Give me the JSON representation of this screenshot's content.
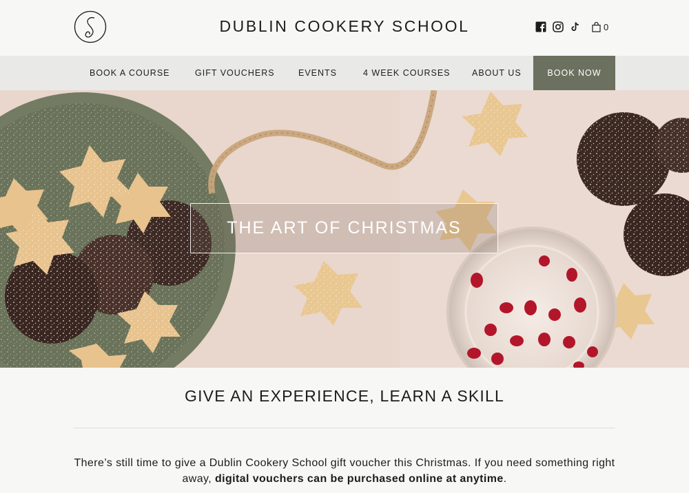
{
  "header": {
    "logo_icon": "s-monogram-logo",
    "title": "DUBLIN COOKERY SCHOOL",
    "social_icons": [
      "facebook-icon",
      "instagram-icon",
      "tiktok-icon"
    ],
    "cart_count": "0"
  },
  "nav": {
    "items": [
      "BOOK A COURSE",
      "GIFT VOUCHERS",
      "EVENTS",
      "4 WEEK COURSES",
      "ABOUT US"
    ],
    "cta": "BOOK NOW"
  },
  "hero": {
    "title": "THE ART OF CHRISTMAS"
  },
  "section": {
    "title": "GIVE AN EXPERIENCE, LEARN A SKILL",
    "text_part1": "There’s still time to give a Dublin Cookery School gift voucher this Christmas. If you need something right away, ",
    "text_bold": "digital vouchers can be purchased online at anytime",
    "text_part2": "."
  },
  "colors": {
    "accent": "#6b705f",
    "nav_bg": "#e9e9e8",
    "page_bg": "#f7f7f6",
    "hero_bg": "#e9d6cc"
  }
}
